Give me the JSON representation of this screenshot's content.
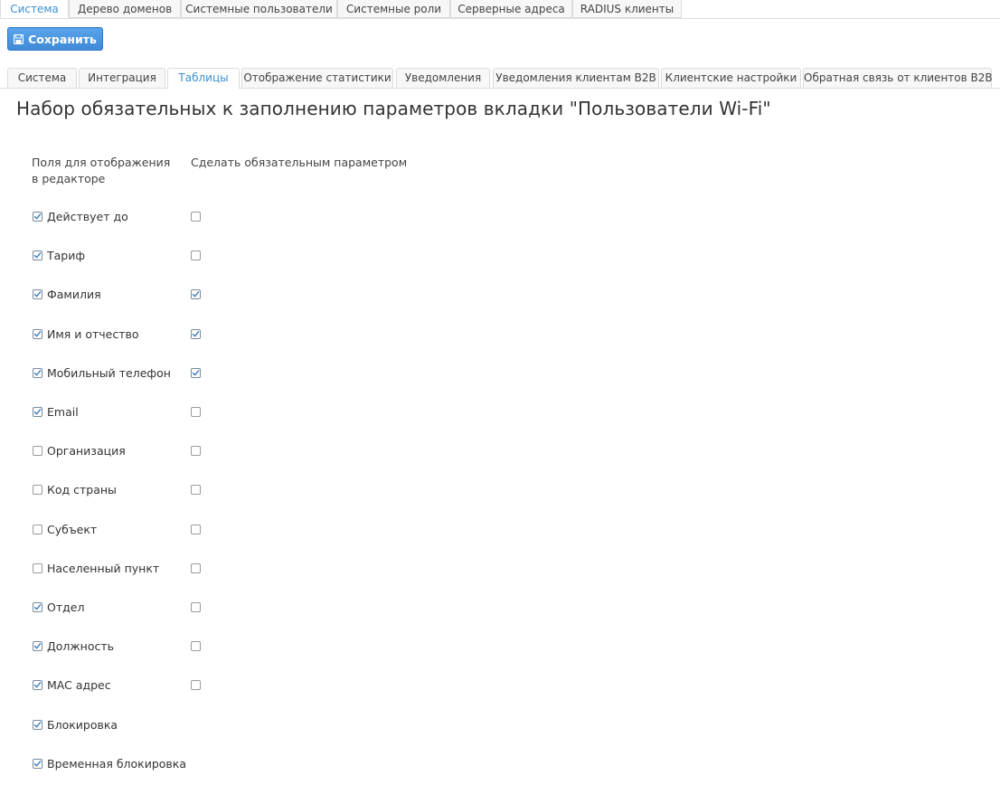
{
  "top_tabs": [
    {
      "label": "Система",
      "active": true
    },
    {
      "label": "Дерево доменов",
      "active": false
    },
    {
      "label": "Системные пользователи",
      "active": false
    },
    {
      "label": "Системные роли",
      "active": false
    },
    {
      "label": "Серверные адреса",
      "active": false
    },
    {
      "label": "RADIUS клиенты",
      "active": false
    }
  ],
  "toolbar": {
    "save_label": "Сохранить",
    "save_icon": "floppy-disk-icon"
  },
  "sub_tabs": [
    {
      "label": "Система",
      "active": false
    },
    {
      "label": "Интеграция",
      "active": false
    },
    {
      "label": "Таблицы",
      "active": true
    },
    {
      "label": "Отображение статистики",
      "active": false
    },
    {
      "label": "Уведомления",
      "active": false
    },
    {
      "label": "Уведомления клиентам B2B",
      "active": false
    },
    {
      "label": "Клиентские настройки",
      "active": false
    },
    {
      "label": "Обратная связь от клиентов B2B",
      "active": false
    }
  ],
  "page": {
    "title": "Набор обязательных к заполнению параметров вкладки \"Пользователи Wi-Fi\"",
    "col_show": "Поля для отображения в редакторе",
    "col_required": "Сделать обязательным параметром"
  },
  "fields": [
    {
      "label": "Действует до",
      "shown": true,
      "required": false,
      "has_required": true
    },
    {
      "label": "Тариф",
      "shown": true,
      "required": false,
      "has_required": true
    },
    {
      "label": "Фамилия",
      "shown": true,
      "required": true,
      "has_required": true
    },
    {
      "label": "Имя и отчество",
      "shown": true,
      "required": true,
      "has_required": true
    },
    {
      "label": "Мобильный телефон",
      "shown": true,
      "required": true,
      "has_required": true
    },
    {
      "label": "Email",
      "shown": true,
      "required": false,
      "has_required": true
    },
    {
      "label": "Организация",
      "shown": false,
      "required": false,
      "has_required": true
    },
    {
      "label": "Код страны",
      "shown": false,
      "required": false,
      "has_required": true
    },
    {
      "label": "Субъект",
      "shown": false,
      "required": false,
      "has_required": true
    },
    {
      "label": "Населенный пункт",
      "shown": false,
      "required": false,
      "has_required": true
    },
    {
      "label": "Отдел",
      "shown": true,
      "required": false,
      "has_required": true
    },
    {
      "label": "Должность",
      "shown": true,
      "required": false,
      "has_required": true
    },
    {
      "label": "MAC адрес",
      "shown": true,
      "required": false,
      "has_required": true
    },
    {
      "label": "Блокировка",
      "shown": true,
      "required": false,
      "has_required": false
    },
    {
      "label": "Временная блокировка",
      "shown": true,
      "required": false,
      "has_required": false
    }
  ],
  "colors": {
    "accent": "#3a8fd3",
    "button": "#3f8ad8"
  }
}
